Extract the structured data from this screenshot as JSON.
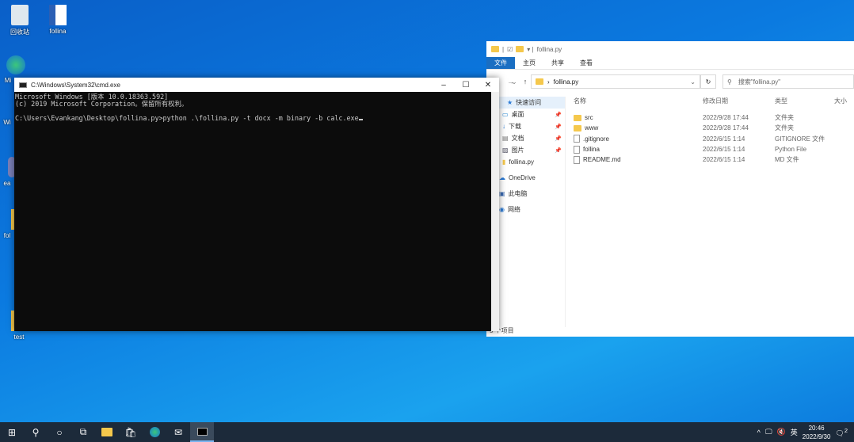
{
  "desktop": {
    "icons": [
      "回收站",
      "follina",
      "Mi",
      "Wi",
      "ea",
      "fol",
      "test"
    ]
  },
  "cmd": {
    "title": "C:\\Windows\\System32\\cmd.exe",
    "lines": [
      "Microsoft Windows [版本 10.0.18363.592]",
      "(c) 2019 Microsoft Corporation。保留所有权利。",
      "",
      "C:\\Users\\Evankang\\Desktop\\follina.py>python .\\follina.py -t docx -m binary -b calc.exe"
    ]
  },
  "explorer": {
    "title": "follina.py",
    "tabs": [
      "文件",
      "主页",
      "共享",
      "查看"
    ],
    "path": "follina.py",
    "search_placeholder": "搜索\"follina.py\"",
    "nav": [
      {
        "label": "快速访问",
        "pin": false
      },
      {
        "label": "桌面",
        "pin": true
      },
      {
        "label": "下载",
        "pin": true
      },
      {
        "label": "文档",
        "pin": true
      },
      {
        "label": "图片",
        "pin": true
      },
      {
        "label": "follina.py",
        "pin": false
      },
      {
        "label": "OneDrive",
        "pin": false
      },
      {
        "label": "此电脑",
        "pin": false
      },
      {
        "label": "网络",
        "pin": false
      }
    ],
    "columns": [
      "名称",
      "修改日期",
      "类型",
      "大小"
    ],
    "files": [
      {
        "name": "src",
        "date": "2022/9/28 17:44",
        "type": "文件夹"
      },
      {
        "name": "www",
        "date": "2022/9/28 17:44",
        "type": "文件夹"
      },
      {
        "name": ".gitignore",
        "date": "2022/6/15 1:14",
        "type": "GITIGNORE 文件"
      },
      {
        "name": "follina",
        "date": "2022/6/15 1:14",
        "type": "Python File"
      },
      {
        "name": "README.md",
        "date": "2022/6/15 1:14",
        "type": "MD 文件"
      }
    ],
    "status": "5 个项目"
  },
  "taskbar": {
    "ime": "英",
    "time": "20:46",
    "date": "2022/9/30",
    "notifications": "2"
  }
}
